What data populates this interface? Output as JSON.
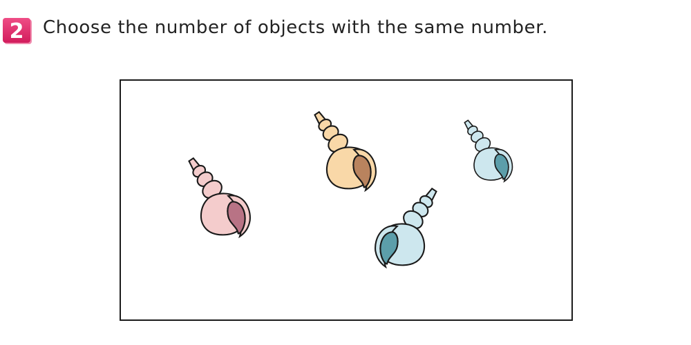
{
  "problem": {
    "number": "2",
    "badge_color": "#e2306c",
    "question": "Choose the number of objects with the same number."
  },
  "picture": {
    "object_icon": "seashell-icon",
    "shells": [
      {
        "color": "pink",
        "body": "#f4cccc",
        "inner": "#b87385"
      },
      {
        "color": "peach",
        "body": "#f9d8a8",
        "inner": "#b9835e"
      },
      {
        "color": "light-blue",
        "body": "#cde7ee",
        "inner": "#5c9eaa"
      },
      {
        "color": "light-blue",
        "body": "#cde7ee",
        "inner": "#5c9eaa"
      }
    ]
  }
}
